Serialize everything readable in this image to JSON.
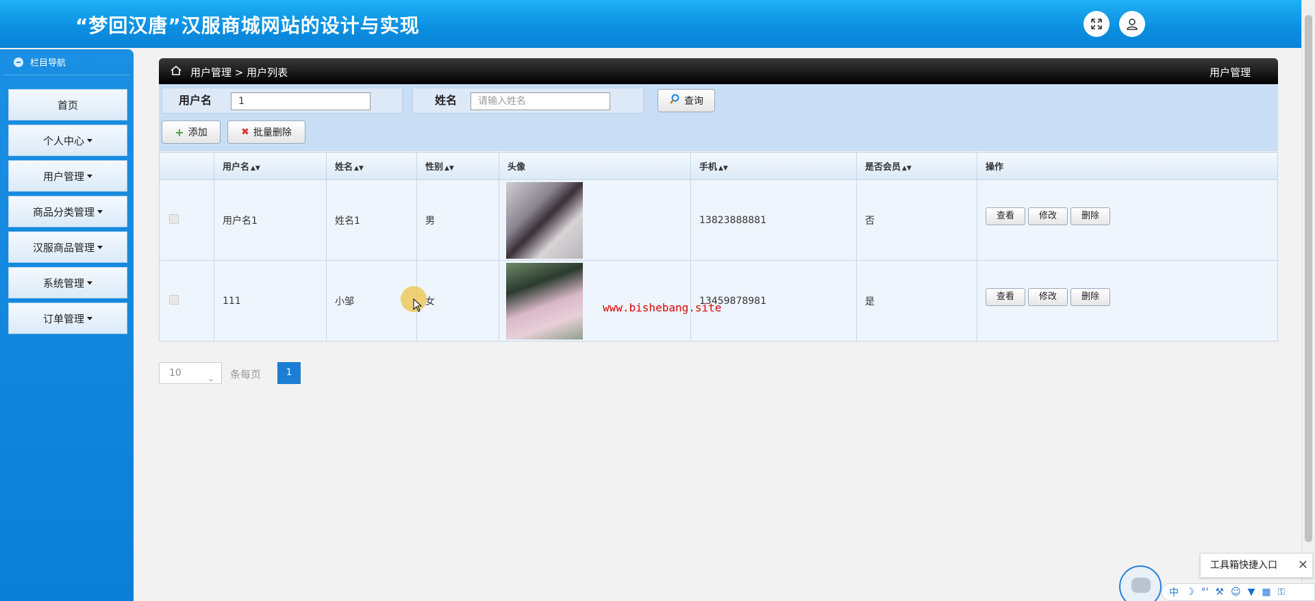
{
  "header": {
    "title": "“梦回汉唐”汉服商城网站的设计与实现",
    "fullscreen_icon": "expand-icon",
    "user_icon": "user-icon"
  },
  "sidebar": {
    "heading": "栏目导航",
    "items": [
      {
        "label": "首页",
        "has_caret": false
      },
      {
        "label": "个人中心",
        "has_caret": true
      },
      {
        "label": "用户管理",
        "has_caret": true
      },
      {
        "label": "商品分类管理",
        "has_caret": true
      },
      {
        "label": "汉服商品管理",
        "has_caret": true
      },
      {
        "label": "系统管理",
        "has_caret": true
      },
      {
        "label": "订单管理",
        "has_caret": true
      }
    ]
  },
  "breadcrumb": {
    "path": "用户管理 > 用户列表",
    "right_title": "用户管理"
  },
  "filter": {
    "username_label": "用户名",
    "username_value": "1",
    "name_label": "姓名",
    "name_placeholder": "请输入姓名",
    "search_label": "查询",
    "add_label": "添加",
    "batch_delete_label": "批量删除"
  },
  "table": {
    "columns": [
      "用户名",
      "姓名",
      "性别",
      "头像",
      "手机",
      "是否会员",
      "操作"
    ],
    "rows": [
      {
        "username": "用户名1",
        "name": "姓名1",
        "gender": "男",
        "phone": "13823888881",
        "member": "否"
      },
      {
        "username": "111",
        "name": "小邹",
        "gender": "女",
        "phone": "13459878981",
        "member": "是"
      }
    ],
    "actions": {
      "view": "查看",
      "edit": "修改",
      "delete": "删除"
    }
  },
  "pagination": {
    "page_size": "10",
    "per_page_label": "条每页",
    "current_page": "1"
  },
  "watermark": "www.bishebang.site",
  "toolbox": {
    "tip": "工具箱快捷入口",
    "close": "✕",
    "bar_first": "中"
  },
  "colors": {
    "header_blue": "#0b8ee0",
    "sidebar_blue": "#1a8fe3",
    "filter_bg": "#c9def5",
    "page_active": "#1a7fd4"
  }
}
